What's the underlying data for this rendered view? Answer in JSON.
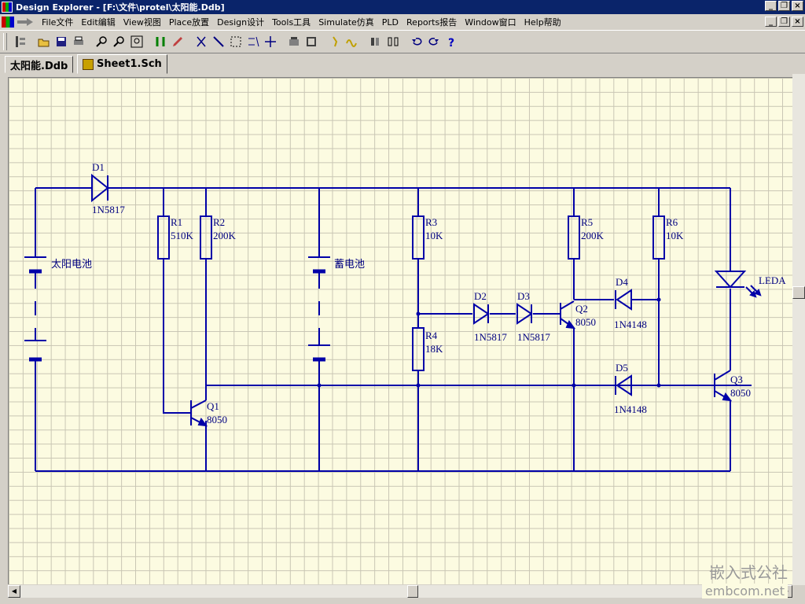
{
  "window": {
    "title": "Design Explorer - [F:\\文件\\protel\\太阳能.Ddb]"
  },
  "menu": [
    "File文件",
    "Edit编辑",
    "View视图",
    "Place放置",
    "Design设计",
    "Tools工具",
    "Simulate仿真",
    "PLD",
    "Reports报告",
    "Window窗口",
    "Help帮助"
  ],
  "tabs": [
    {
      "label": "太阳能.Ddb"
    },
    {
      "label": "Sheet1.Sch"
    }
  ],
  "schematic": {
    "components": {
      "D1": {
        "ref": "D1",
        "value": "1N5817"
      },
      "R1": {
        "ref": "R1",
        "value": "510K"
      },
      "R2": {
        "ref": "R2",
        "value": "200K"
      },
      "BAT1": {
        "value": "太阳电池"
      },
      "BAT2": {
        "value": "蓄电池"
      },
      "R3": {
        "ref": "R3",
        "value": "10K"
      },
      "R4": {
        "ref": "R4",
        "value": "18K"
      },
      "D2": {
        "ref": "D2",
        "value": "1N5817"
      },
      "D3": {
        "ref": "D3",
        "value": "1N5817"
      },
      "Q1": {
        "ref": "Q1",
        "value": "8050"
      },
      "Q2": {
        "ref": "Q2",
        "value": "8050"
      },
      "Q3": {
        "ref": "Q3",
        "value": "8050"
      },
      "R5": {
        "ref": "R5",
        "value": "200K"
      },
      "R6": {
        "ref": "R6",
        "value": "10K"
      },
      "D4": {
        "ref": "D4",
        "value": "1N4148"
      },
      "D5": {
        "ref": "D5",
        "value": "1N4148"
      },
      "LED": {
        "ref": "LEDA"
      }
    }
  },
  "watermark": {
    "line1": "嵌入式公社",
    "line2": "embcom.net"
  },
  "colors": {
    "wire": "#0000a8",
    "sheet": "#fcfbe1",
    "titlebar": "#0a246a"
  }
}
